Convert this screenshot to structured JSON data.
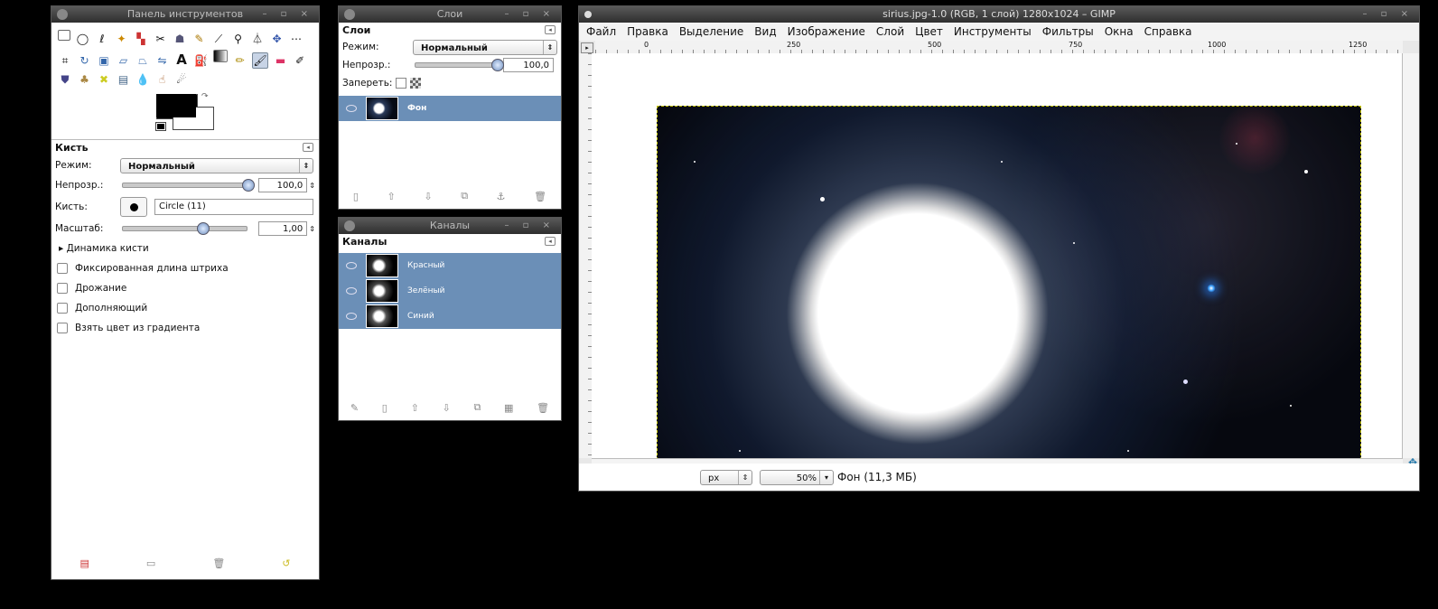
{
  "toolbox": {
    "title": "Панель инструментов",
    "section": "Кисть",
    "mode_label": "Режим:",
    "mode_value": "Нормальный",
    "opacity_label": "Непрозр.:",
    "opacity_value": "100,0",
    "opacity_level": 1.0,
    "brush_label": "Кисть:",
    "brush_value": "Circle (11)",
    "scale_label": "Масштаб:",
    "scale_value": "1,00",
    "scale_level": 0.62,
    "dynamics_label": "▸ Динамика кисти",
    "checks": [
      "Фиксированная длина штриха",
      "Дрожание",
      "Дополняющий",
      "Взять цвет из градиента"
    ],
    "fg_color": "#000000",
    "bg_color": "#ffffff"
  },
  "layers": {
    "title": "Слои",
    "section": "Слои",
    "mode_label": "Режим:",
    "mode_value": "Нормальный",
    "opacity_label": "Непрозр.:",
    "opacity_value": "100,0",
    "lock_label": "Запереть:",
    "layer_name": "Фон"
  },
  "channels": {
    "title": "Каналы",
    "section": "Каналы",
    "items": [
      "Красный",
      "Зелёный",
      "Синий"
    ]
  },
  "image_window": {
    "title": "sirius.jpg-1.0 (RGB, 1 слой) 1280x1024 – GIMP",
    "menu": [
      "Файл",
      "Правка",
      "Выделение",
      "Вид",
      "Изображение",
      "Слой",
      "Цвет",
      "Инструменты",
      "Фильтры",
      "Окна",
      "Справка"
    ],
    "ruler_ticks": [
      "0",
      "250",
      "500",
      "750",
      "1000",
      "1250"
    ],
    "unit": "px",
    "zoom": "50%",
    "status": "Фон (11,3 МБ)"
  },
  "colors": {
    "selection_blue": "#6b8fb7",
    "titlebar": "#3a3a3a"
  }
}
